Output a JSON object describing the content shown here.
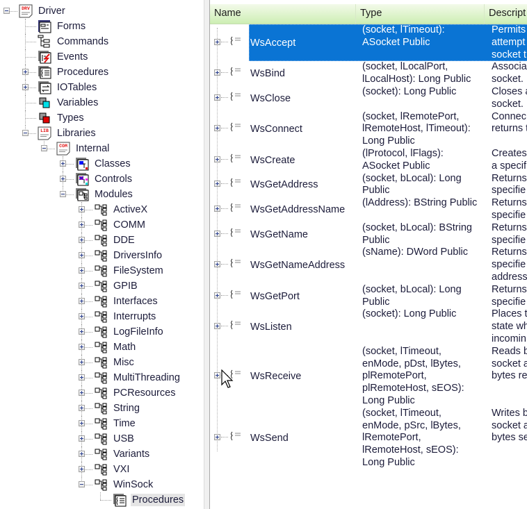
{
  "tree": [
    {
      "label": "Driver",
      "level": 0,
      "expander": "minus",
      "icon": "driver-doc-icon",
      "badge": "DRV"
    },
    {
      "label": "Forms",
      "level": 1,
      "expander": "none",
      "icon": "forms-icon"
    },
    {
      "label": "Commands",
      "level": 1,
      "expander": "none",
      "icon": "commands-icon"
    },
    {
      "label": "Events",
      "level": 1,
      "expander": "none",
      "icon": "events-icon"
    },
    {
      "label": "Procedures",
      "level": 1,
      "expander": "plus",
      "icon": "procedures-icon"
    },
    {
      "label": "IOTables",
      "level": 1,
      "expander": "plus",
      "icon": "iotables-icon"
    },
    {
      "label": "Variables",
      "level": 1,
      "expander": "none",
      "icon": "variables-icon"
    },
    {
      "label": "Types",
      "level": 1,
      "expander": "none",
      "icon": "types-icon"
    },
    {
      "label": "Libraries",
      "level": 1,
      "expander": "minus",
      "icon": "libraries-doc-icon",
      "badge": "LIB"
    },
    {
      "label": "Internal",
      "level": 2,
      "expander": "minus",
      "icon": "internal-doc-icon",
      "badge": "COM"
    },
    {
      "label": "Classes",
      "level": 3,
      "expander": "plus",
      "icon": "classes-icon"
    },
    {
      "label": "Controls",
      "level": 3,
      "expander": "plus",
      "icon": "controls-icon"
    },
    {
      "label": "Modules",
      "level": 3,
      "expander": "minus",
      "icon": "modules-icon"
    },
    {
      "label": "ActiveX",
      "level": 4,
      "expander": "plus",
      "icon": "module-icon"
    },
    {
      "label": "COMM",
      "level": 4,
      "expander": "plus",
      "icon": "module-icon"
    },
    {
      "label": "DDE",
      "level": 4,
      "expander": "plus",
      "icon": "module-icon"
    },
    {
      "label": "DriversInfo",
      "level": 4,
      "expander": "plus",
      "icon": "module-icon"
    },
    {
      "label": "FileSystem",
      "level": 4,
      "expander": "plus",
      "icon": "module-icon"
    },
    {
      "label": "GPIB",
      "level": 4,
      "expander": "plus",
      "icon": "module-icon"
    },
    {
      "label": "Interfaces",
      "level": 4,
      "expander": "plus",
      "icon": "module-icon"
    },
    {
      "label": "Interrupts",
      "level": 4,
      "expander": "plus",
      "icon": "module-icon"
    },
    {
      "label": "LogFileInfo",
      "level": 4,
      "expander": "plus",
      "icon": "module-icon"
    },
    {
      "label": "Math",
      "level": 4,
      "expander": "plus",
      "icon": "module-icon"
    },
    {
      "label": "Misc",
      "level": 4,
      "expander": "plus",
      "icon": "module-icon"
    },
    {
      "label": "MultiThreading",
      "level": 4,
      "expander": "plus",
      "icon": "module-icon"
    },
    {
      "label": "PCResources",
      "level": 4,
      "expander": "plus",
      "icon": "module-icon"
    },
    {
      "label": "String",
      "level": 4,
      "expander": "plus",
      "icon": "module-icon"
    },
    {
      "label": "Time",
      "level": 4,
      "expander": "plus",
      "icon": "module-icon"
    },
    {
      "label": "USB",
      "level": 4,
      "expander": "plus",
      "icon": "module-icon"
    },
    {
      "label": "Variants",
      "level": 4,
      "expander": "plus",
      "icon": "module-icon"
    },
    {
      "label": "VXI",
      "level": 4,
      "expander": "plus",
      "icon": "module-icon"
    },
    {
      "label": "WinSock",
      "level": 4,
      "expander": "minus",
      "icon": "module-icon"
    },
    {
      "label": "Procedures",
      "level": 5,
      "expander": "none",
      "icon": "procedures-icon",
      "selected": true
    }
  ],
  "list": {
    "columns": [
      "Name",
      "Type",
      "Descript"
    ],
    "selection_color": "#0a74d4",
    "rows": [
      {
        "name": "WsAccept",
        "selected": true,
        "type": [
          "(socket, lTimeout):",
          "ASocket Public"
        ],
        "desc": [
          "Permits",
          "attempt",
          "socket t"
        ]
      },
      {
        "name": "WsBind",
        "type": [
          "(socket, lLocalPort,",
          "lLocalHost): Long Public"
        ],
        "desc": [
          "Associa",
          "socket."
        ]
      },
      {
        "name": "WsClose",
        "type": [
          "(socket): Long Public"
        ],
        "desc": [
          "Closes a",
          "socket."
        ]
      },
      {
        "name": "WsConnect",
        "type": [
          "(socket, lRemotePort,",
          "lRemoteHost, lTimeout):",
          "Long Public"
        ],
        "desc": [
          "Connec",
          "returns t"
        ]
      },
      {
        "name": "WsCreate",
        "type": [
          "(lProtocol, lFlags):",
          "ASocket Public"
        ],
        "desc": [
          "Creates",
          "a specif"
        ]
      },
      {
        "name": "WsGetAddress",
        "type": [
          "(socket, bLocal): Long",
          "Public"
        ],
        "desc": [
          "Returns",
          "specifie"
        ]
      },
      {
        "name": "WsGetAddressName",
        "type": [
          "(lAddress): BString Public"
        ],
        "desc": [
          "Returns",
          "specifie"
        ]
      },
      {
        "name": "WsGetName",
        "type": [
          "(socket, bLocal): BString",
          "Public"
        ],
        "desc": [
          "Returns",
          "specifie"
        ]
      },
      {
        "name": "WsGetNameAddress",
        "type": [
          "(sName): DWord Public"
        ],
        "desc": [
          "Returns",
          "specifie",
          "address"
        ]
      },
      {
        "name": "WsGetPort",
        "type": [
          "(socket, bLocal): Long",
          "Public"
        ],
        "desc": [
          "Returns",
          "specifie"
        ]
      },
      {
        "name": "WsListen",
        "type": [
          "(socket): Long Public"
        ],
        "desc": [
          "Places t",
          "state wh",
          "incomin"
        ]
      },
      {
        "name": "WsReceive",
        "type": [
          "(socket, lTimeout,",
          "enMode, pDst, lBytes,",
          "plRemotePort,",
          "plRemoteHost, sEOS):",
          "Long Public"
        ],
        "desc": [
          "Reads b",
          "socket a",
          "bytes re"
        ]
      },
      {
        "name": "WsSend",
        "type": [
          "(socket, lTimeout,",
          "enMode, pSrc, lBytes,",
          "lRemotePort,",
          "lRemoteHost, sEOS):",
          "Long Public"
        ],
        "desc": [
          "Writes b",
          "socket a",
          "bytes se"
        ]
      }
    ]
  }
}
